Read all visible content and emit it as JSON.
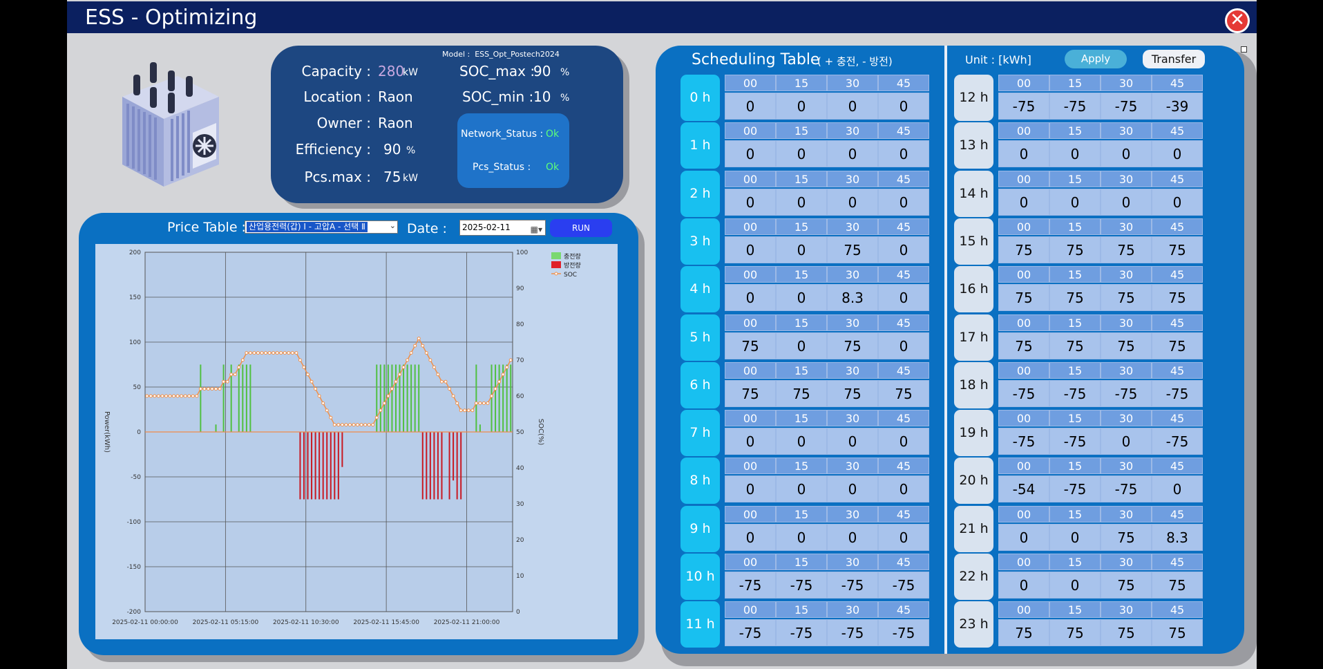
{
  "title": "ESS - Optimizing",
  "close_icon": "close-icon",
  "info": {
    "model_label": "Model :",
    "model_value": "ESS_Opt_Postech2024",
    "capacity": {
      "label": "Capacity :",
      "value": "280",
      "unit": "kW"
    },
    "location": {
      "label": "Location :",
      "value": "Raon"
    },
    "owner": {
      "label": "Owner :",
      "value": "Raon"
    },
    "efficiency": {
      "label": "Efficiency :",
      "value": "90",
      "unit": "%"
    },
    "pcs_max": {
      "label": "Pcs.max :",
      "value": "75",
      "unit": "kW"
    },
    "soc_max": {
      "label": "SOC_max :",
      "value": "90",
      "unit": "%"
    },
    "soc_min": {
      "label": "SOC_min :",
      "value": "10",
      "unit": "%"
    },
    "network_status": {
      "label": "Network_Status :",
      "value": "Ok"
    },
    "pcs_status": {
      "label": "Pcs_Status :",
      "value": "Ok"
    }
  },
  "price_table": {
    "label": "Price Table :",
    "selected": "산업용전력(갑) Ⅰ - 고압A - 선택 Ⅱ",
    "date_label": "Date :",
    "date_value": "2025-02-11",
    "run_label": "RUN"
  },
  "schedule": {
    "title": "Scheduling Table",
    "subtitle": "( + 충전, - 방전)",
    "unit": "Unit : [kWh]",
    "apply_label": "Apply",
    "transfer_label": "Transfer",
    "minutes": [
      "00",
      "15",
      "30",
      "45"
    ],
    "rows": [
      {
        "hour": "0 h",
        "values": [
          "0",
          "0",
          "0",
          "0"
        ]
      },
      {
        "hour": "1 h",
        "values": [
          "0",
          "0",
          "0",
          "0"
        ]
      },
      {
        "hour": "2 h",
        "values": [
          "0",
          "0",
          "0",
          "0"
        ]
      },
      {
        "hour": "3 h",
        "values": [
          "0",
          "0",
          "75",
          "0"
        ]
      },
      {
        "hour": "4 h",
        "values": [
          "0",
          "0",
          "8.3",
          "0"
        ]
      },
      {
        "hour": "5 h",
        "values": [
          "75",
          "0",
          "75",
          "0"
        ]
      },
      {
        "hour": "6 h",
        "values": [
          "75",
          "75",
          "75",
          "75"
        ]
      },
      {
        "hour": "7 h",
        "values": [
          "0",
          "0",
          "0",
          "0"
        ]
      },
      {
        "hour": "8 h",
        "values": [
          "0",
          "0",
          "0",
          "0"
        ]
      },
      {
        "hour": "9 h",
        "values": [
          "0",
          "0",
          "0",
          "0"
        ]
      },
      {
        "hour": "10 h",
        "values": [
          "-75",
          "-75",
          "-75",
          "-75"
        ]
      },
      {
        "hour": "11 h",
        "values": [
          "-75",
          "-75",
          "-75",
          "-75"
        ]
      },
      {
        "hour": "12 h",
        "values": [
          "-75",
          "-75",
          "-75",
          "-39"
        ]
      },
      {
        "hour": "13 h",
        "values": [
          "0",
          "0",
          "0",
          "0"
        ]
      },
      {
        "hour": "14 h",
        "values": [
          "0",
          "0",
          "0",
          "0"
        ]
      },
      {
        "hour": "15 h",
        "values": [
          "75",
          "75",
          "75",
          "75"
        ]
      },
      {
        "hour": "16 h",
        "values": [
          "75",
          "75",
          "75",
          "75"
        ]
      },
      {
        "hour": "17 h",
        "values": [
          "75",
          "75",
          "75",
          "75"
        ]
      },
      {
        "hour": "18 h",
        "values": [
          "-75",
          "-75",
          "-75",
          "-75"
        ]
      },
      {
        "hour": "19 h",
        "values": [
          "-75",
          "-75",
          "0",
          "-75"
        ]
      },
      {
        "hour": "20 h",
        "values": [
          "-54",
          "-75",
          "-75",
          "0"
        ]
      },
      {
        "hour": "21 h",
        "values": [
          "0",
          "0",
          "75",
          "8.3"
        ]
      },
      {
        "hour": "22 h",
        "values": [
          "0",
          "0",
          "75",
          "75"
        ]
      },
      {
        "hour": "23 h",
        "values": [
          "75",
          "75",
          "75",
          "75"
        ]
      }
    ]
  },
  "chart_data": {
    "type": "bar",
    "ylabel": "Power(kWh)",
    "y2label": "SOC(%)",
    "ylim": [
      -200,
      200
    ],
    "y2lim": [
      0,
      100
    ],
    "yticks": [
      200,
      150,
      100,
      50,
      0,
      -50,
      -100,
      -150,
      -200
    ],
    "y2ticks": [
      100,
      90,
      80,
      70,
      60,
      50,
      40,
      30,
      20,
      10,
      0
    ],
    "xticks": [
      "2025-02-11 00:00:00",
      "2025-02-11 05:15:00",
      "2025-02-11 10:30:00",
      "2025-02-11 15:45:00",
      "2025-02-11 21:00:00"
    ],
    "grid": true,
    "legend_position": "top-right",
    "legend": [
      {
        "name": "충전량",
        "color": "#7ad870"
      },
      {
        "name": "방전량",
        "color": "#e0202a"
      },
      {
        "name": "SOC",
        "color": "#f0904a"
      }
    ],
    "power": [
      0,
      0,
      0,
      0,
      0,
      0,
      0,
      0,
      0,
      0,
      0,
      0,
      0,
      0,
      75,
      0,
      0,
      0,
      8.3,
      0,
      75,
      0,
      75,
      0,
      75,
      75,
      75,
      75,
      0,
      0,
      0,
      0,
      0,
      0,
      0,
      0,
      0,
      0,
      0,
      0,
      -75,
      -75,
      -75,
      -75,
      -75,
      -75,
      -75,
      -75,
      -75,
      -75,
      -75,
      -39,
      0,
      0,
      0,
      0,
      0,
      0,
      0,
      0,
      75,
      75,
      75,
      75,
      75,
      75,
      75,
      75,
      75,
      75,
      75,
      75,
      -75,
      -75,
      -75,
      -75,
      -75,
      -75,
      0,
      -75,
      -54,
      -75,
      -75,
      0,
      0,
      0,
      75,
      8.3,
      0,
      0,
      75,
      75,
      75,
      75,
      75,
      75
    ],
    "soc": [
      60,
      60,
      60,
      60,
      60,
      60,
      60,
      60,
      60,
      60,
      60,
      60,
      60,
      60,
      62,
      62,
      62,
      62,
      62,
      62,
      64,
      64,
      66,
      66,
      68,
      70,
      72,
      72,
      72,
      72,
      72,
      72,
      72,
      72,
      72,
      72,
      72,
      72,
      72,
      72,
      70,
      68,
      66,
      64,
      62,
      60,
      58,
      56,
      54,
      52,
      52,
      52,
      52,
      52,
      52,
      52,
      52,
      52,
      52,
      52,
      54,
      56,
      58,
      60,
      62,
      64,
      66,
      68,
      70,
      72,
      74,
      76,
      74,
      72,
      70,
      68,
      66,
      64,
      64,
      62,
      60,
      58,
      56,
      56,
      56,
      56,
      58,
      58,
      58,
      58,
      60,
      62,
      64,
      66,
      68,
      70
    ]
  }
}
